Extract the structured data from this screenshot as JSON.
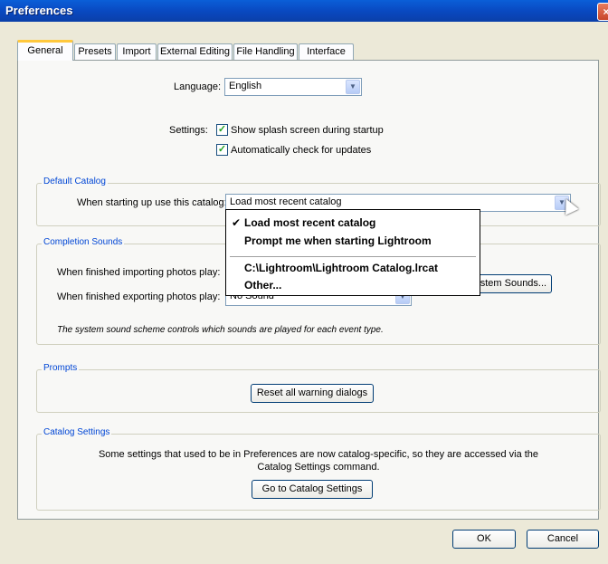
{
  "window": {
    "title": "Preferences",
    "close_icon": "close-icon"
  },
  "tabs": [
    {
      "label": "General"
    },
    {
      "label": "Presets"
    },
    {
      "label": "Import"
    },
    {
      "label": "External Editing"
    },
    {
      "label": "File Handling"
    },
    {
      "label": "Interface"
    }
  ],
  "general": {
    "language_label": "Language:",
    "language_value": "English",
    "settings_label": "Settings:",
    "splash_label": "Show splash screen during startup",
    "splash_checked": true,
    "updates_label": "Automatically check for updates",
    "updates_checked": true
  },
  "default_catalog": {
    "title": "Default Catalog",
    "label": "When starting up use this catalog:",
    "value": "Load most recent catalog",
    "options": [
      "Load most recent catalog",
      "Prompt me when starting Lightroom",
      "C:\\Lightroom\\Lightroom Catalog.lrcat",
      "Other..."
    ],
    "selected_mark": "✔"
  },
  "completion_sounds": {
    "title": "Completion Sounds",
    "import_label": "When finished importing photos play:",
    "export_label": "When finished exporting photos play:",
    "export_value": "No Sound",
    "system_sounds_button": "System Sounds...",
    "note": "The system sound scheme controls which sounds are played for each event type."
  },
  "prompts": {
    "title": "Prompts",
    "reset_button": "Reset all warning dialogs"
  },
  "catalog_settings": {
    "title": "Catalog Settings",
    "line1": "Some settings that used to be in Preferences are now catalog-specific, so they are accessed via the",
    "line2": "Catalog Settings command.",
    "button": "Go to Catalog Settings"
  },
  "footer": {
    "ok": "OK",
    "cancel": "Cancel"
  },
  "colors": {
    "titlebar": "#0a52d0",
    "group_title": "#0046d5",
    "tab_highlight": "#ffc83c"
  }
}
